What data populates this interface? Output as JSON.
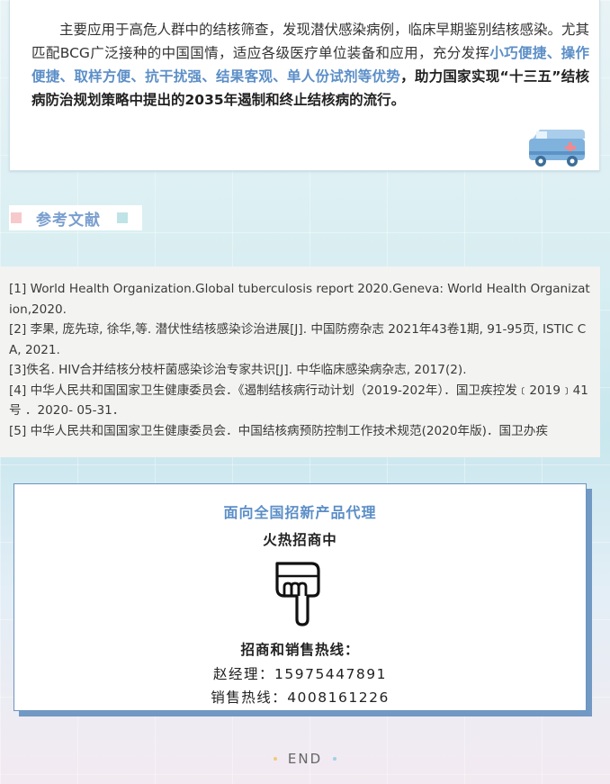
{
  "intro": {
    "line1": "主要应用于高危人群中的结核筛查，发现潜伏感染病例，临床早期鉴别结核感染。尤其匹配BCG广泛接种的中国国情，适应各级医疗单位装备和应用，充分发挥",
    "highlight": "小巧便捷、操作便捷、取样方便、抗干扰强、结果客观、单人份试剂等优势",
    "strong": "，助力国家实现“十三五”结核病防治规划策略中提出的2035年遏制和终止结核病的流行。"
  },
  "references": {
    "heading": "参考文献",
    "items": [
      "[1] World Health Organization.Global tuberculosis report 2020.Geneva:    World Health Organization,2020.",
      "[2] 李果, 庞先琼, 徐华,等. 潜伏性结核感染诊治进展[J]. 中国防痨杂志 2021年43卷1期, 91-95页, ISTIC CA, 2021.",
      "[3]佚名. HIV合并结核分枝杆菌感染诊治专家共识[J]. 中华临床感染病杂志, 2017(2).",
      "[4] 中华人民共和国国家卫生健康委员会．《遏制结核病行动计划（2019-202年）．国卫疾控发﹝2019﹞41号 ．2020- 05-31．",
      "[5] 中华人民共和国国家卫生健康委员会．中国结核病预防控制工作技术规范(2020年版)．国卫办疾"
    ]
  },
  "contact": {
    "headline": "面向全国招新产品代理",
    "subheadline": "火热招商中",
    "hotline_label": "招商和销售热线：",
    "manager": "赵经理：15975447891",
    "sales": "销售热线：4008161226"
  },
  "footer": {
    "end": "END"
  },
  "colors": {
    "accent": "#5b8ec7",
    "frame": "#7199c4",
    "pink": "#f6c9cc",
    "mint": "#bfe3e6"
  },
  "icons": {
    "ambulance": "ambulance-icon",
    "hand": "pointing-down-hand-icon"
  }
}
